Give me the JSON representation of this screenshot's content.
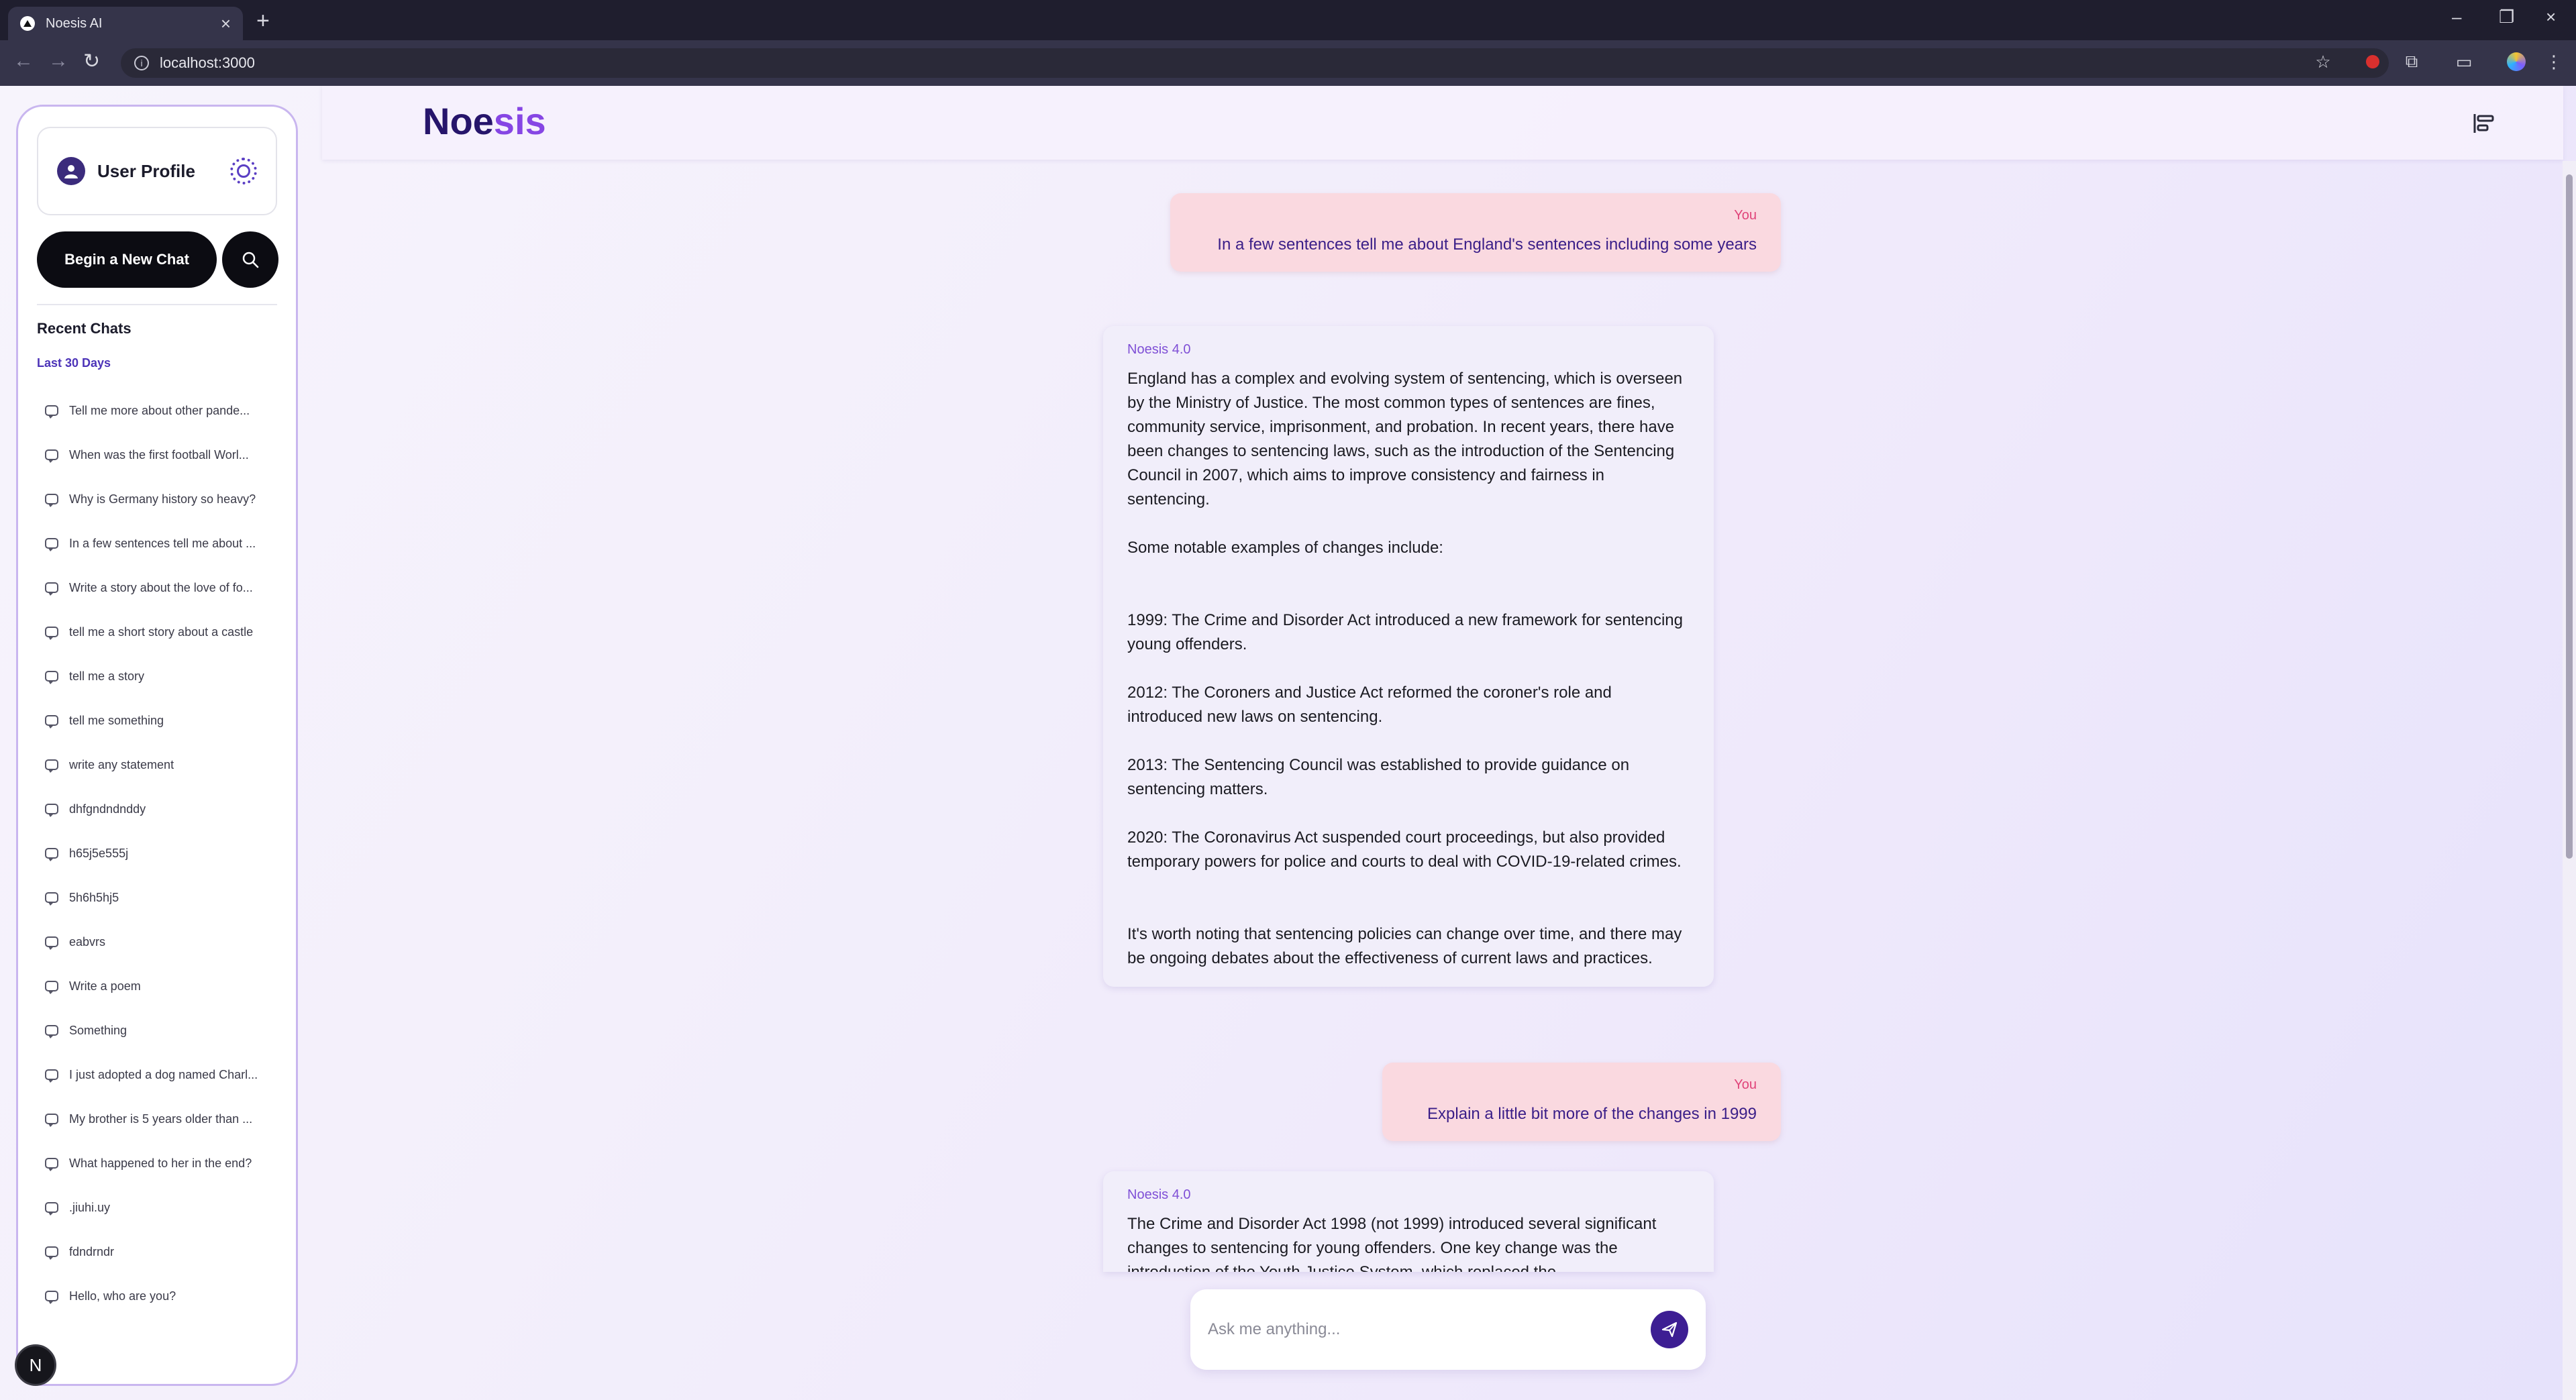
{
  "browser": {
    "tab_title": "Noesis AI",
    "url": "localhost:3000",
    "tab_close": "×",
    "new_tab": "+",
    "minimize": "–",
    "restore": "❐",
    "close": "×"
  },
  "sidebar": {
    "profile_label": "User Profile",
    "new_chat_label": "Begin a New Chat",
    "recent_title": "Recent Chats",
    "period_label": "Last 30 Days",
    "chats": [
      "Tell me more about other pande...",
      "When was the first football Worl...",
      "Why is Germany history so heavy?",
      "In a few sentences tell me about ...",
      "Write a story about the love of fo...",
      "tell me a short story about a castle",
      "tell me a story",
      "tell me something",
      "write any statement",
      "dhfgndndnddy",
      "h65j5e555j",
      "5h6h5hj5",
      "eabvrs",
      "Write a poem",
      "Something",
      "I just adopted a dog named Charl...",
      "My brother is 5 years older than ...",
      "What happened to her in the end?",
      ".jiuhi.uy",
      "fdndrndr",
      "Hello, who are you?"
    ],
    "badge_letter": "N"
  },
  "header": {
    "brand_prefix": "Noe",
    "brand_suffix": "sis"
  },
  "messages": [
    {
      "role": "user",
      "author": "You",
      "text": "In a few sentences tell me about England's sentences including some years"
    },
    {
      "role": "assistant",
      "author": "Noesis 4.0",
      "text": "England has a complex and evolving system of sentencing, which is overseen by the Ministry of Justice. The most common types of sentences are fines, community service, imprisonment, and probation. In recent years, there have been changes to sentencing laws, such as the introduction of the Sentencing Council in 2007, which aims to improve consistency and fairness in sentencing.\n\nSome notable examples of changes include:\n\n\n1999: The Crime and Disorder Act introduced a new framework for sentencing young offenders.\n\n2012: The Coroners and Justice Act reformed the coroner's role and introduced new laws on sentencing.\n\n2013: The Sentencing Council was established to provide guidance on sentencing matters.\n\n2020: The Coronavirus Act suspended court proceedings, but also provided temporary powers for police and courts to deal with COVID-19-related crimes.\n\n\nIt's worth noting that sentencing policies can change over time, and there may be ongoing debates about the effectiveness of current laws and practices."
    },
    {
      "role": "user",
      "author": "You",
      "text": "Explain a little bit more of the changes in 1999"
    },
    {
      "role": "assistant",
      "author": "Noesis 4.0",
      "text": "The Crime and Disorder Act 1998 (not 1999) introduced several significant changes to sentencing for young offenders. One key change was the introduction of the Youth Justice System, which replaced the"
    }
  ],
  "composer": {
    "placeholder": "Ask me anything..."
  },
  "colors": {
    "brand_dark": "#26156b",
    "brand_accent": "#8646e4",
    "user_bubble": "#fad9e0",
    "ai_bubble": "#f1eefa",
    "send_button": "#3d1e93"
  }
}
